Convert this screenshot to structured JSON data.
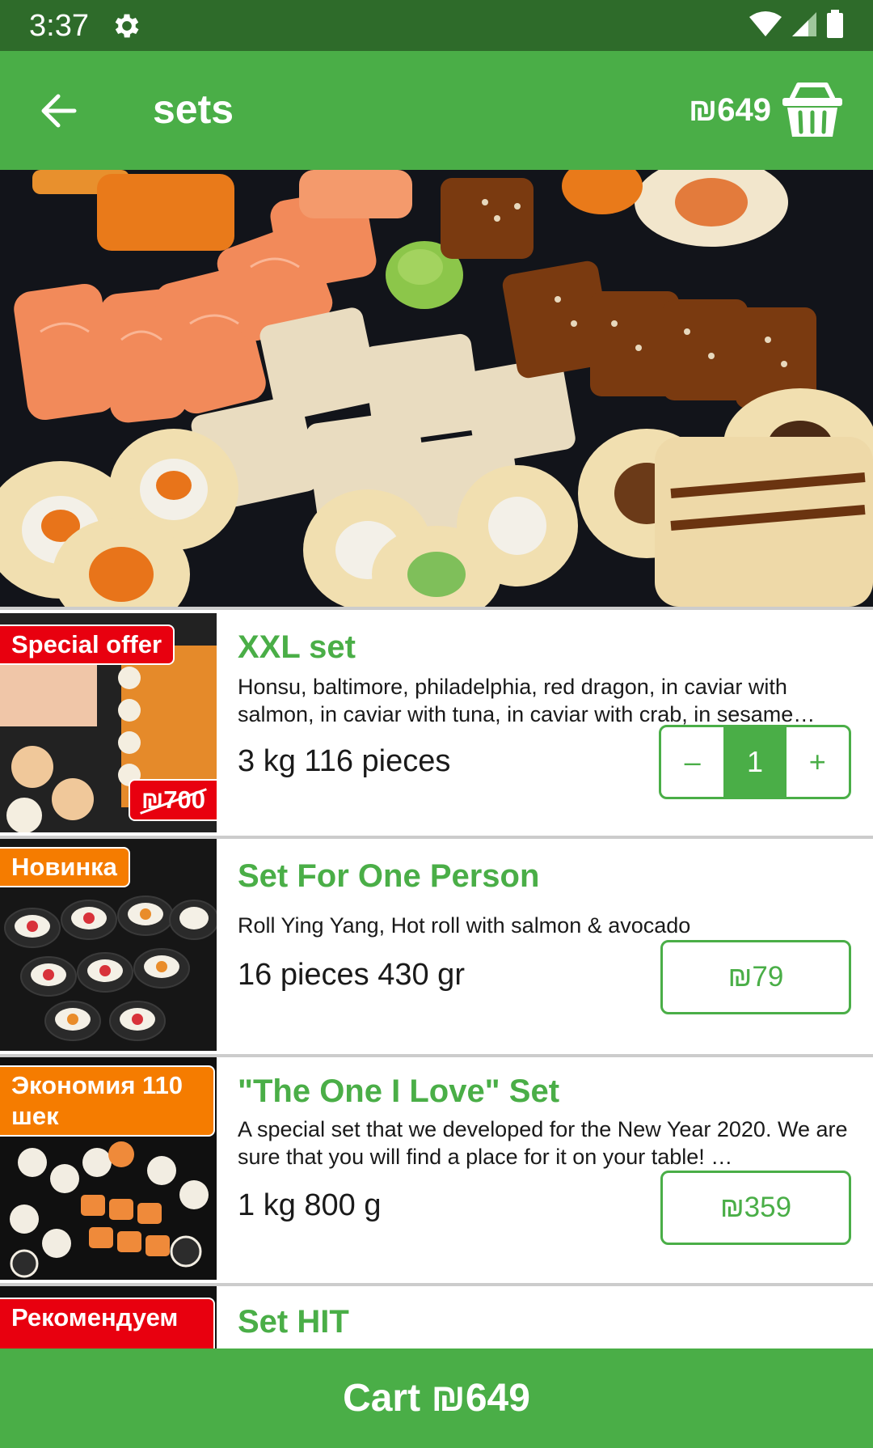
{
  "status_bar": {
    "time": "3:37"
  },
  "app_bar": {
    "title": "sets",
    "cart_total": "₪649"
  },
  "hero": {
    "alt": "sushi set photo"
  },
  "items": [
    {
      "badge": "Special offer",
      "old_price": "₪700",
      "title": "XXL set",
      "description": "Honsu, baltimore, philadelphia, red dragon, in caviar with salmon, in caviar with tuna, in caviar with crab, in sesame…",
      "weight": "3 kg 116 pieces",
      "quantity": "1",
      "minus": "–",
      "plus": "+"
    },
    {
      "badge": "Новинка",
      "title": "Set For One Person",
      "description": "Roll Ying Yang, Hot roll with salmon & avocado",
      "weight": "16 pieces 430 gr",
      "price": "₪79"
    },
    {
      "badge": "Экономия 110 шек",
      "title": "\"The One I Love\" Set",
      "description": "A special set that we developed for the New Year 2020. We are sure that you will find a place for it on your table! …",
      "weight": "1 kg 800 g",
      "price": "₪359"
    },
    {
      "badge": "Рекомендуем",
      "title": "Set HIT"
    }
  ],
  "cart_bar": {
    "label": "Cart ₪649"
  },
  "colors": {
    "primary": "#4aae47",
    "status_bar": "#2e6b2a",
    "badge_red": "#e8000f",
    "badge_orange": "#f57c00"
  }
}
